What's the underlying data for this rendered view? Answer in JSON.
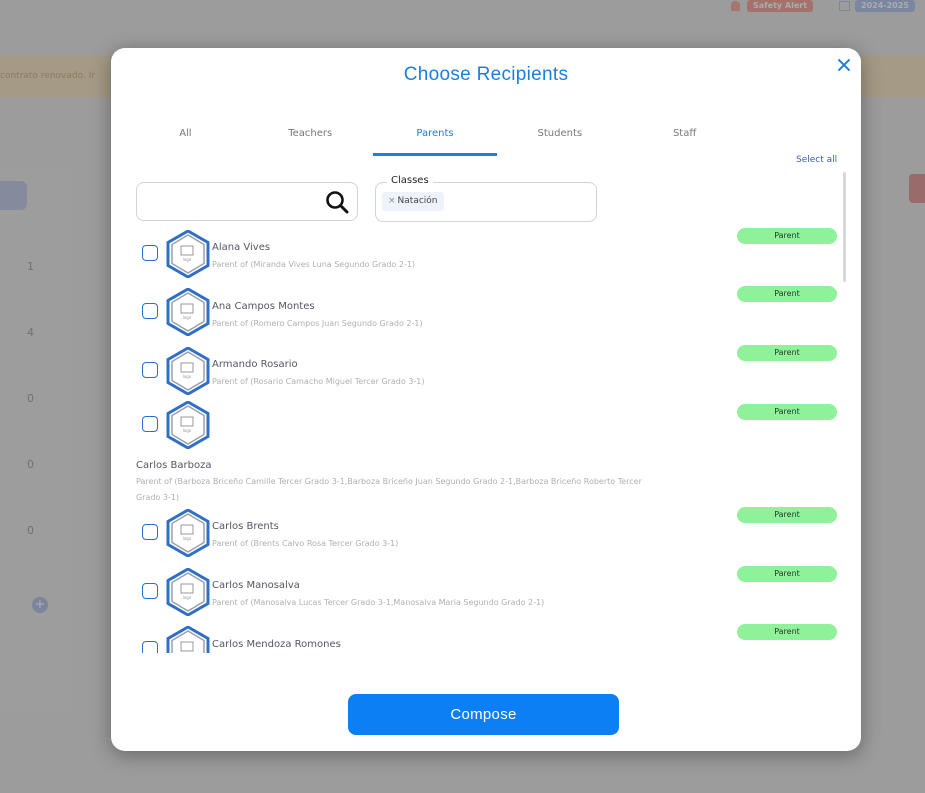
{
  "background": {
    "safety_alert": "Safety Alert",
    "school_year": "2024-2025",
    "banner_text": "contrato renovado. Ir",
    "side_numbers": [
      "1",
      "4",
      "0",
      "0",
      "0"
    ]
  },
  "modal": {
    "title": "Choose Recipients",
    "tabs": [
      "All",
      "Teachers",
      "Parents",
      "Students",
      "Staff"
    ],
    "active_tab": "Parents",
    "select_all": "Select all",
    "search": {
      "value": "",
      "placeholder": ""
    },
    "classes": {
      "label": "Classes",
      "chip": "Natación",
      "chip_remove": "×"
    },
    "recipients": [
      {
        "name": "Alana Vives",
        "sub": "Parent of (Miranda Vives Luna Segundo Grado 2-1)",
        "role": "Parent"
      },
      {
        "name": "Ana Campos Montes",
        "sub": "Parent of (Romero Campos Juan Segundo Grado 2-1)",
        "role": "Parent"
      },
      {
        "name": "Armando Rosario",
        "sub": "Parent of (Rosario Camacho Miguel Tercer Grado 3-1)",
        "role": "Parent"
      },
      {
        "name": "Carlos Barboza",
        "sub": "Parent of (Barboza Briceño Camille Tercer Grado 3-1,Barboza Briceño Juan Segundo Grado 2-1,Barboza Briceño Roberto Tercer Grado 3-1)",
        "sub_line1": "Parent of (Barboza Briceño Camille Tercer Grado 3-1,Barboza Briceño Juan Segundo Grado 2-1,Barboza Briceño Roberto Tercer",
        "sub_line2": "Grado 3-1)",
        "role": "Parent"
      },
      {
        "name": "Carlos Brents",
        "sub": "Parent of (Brents Calvo Rosa Tercer Grado 3-1)",
        "role": "Parent"
      },
      {
        "name": "Carlos Manosalva",
        "sub": "Parent of (Manosalva Lucas Tercer Grado 3-1,Manosalva Maria Segundo Grado 2-1)",
        "role": "Parent"
      },
      {
        "name": "Carlos Mendoza Romones",
        "sub": "",
        "role": "Parent"
      }
    ],
    "compose_label": "Compose",
    "colors": {
      "accent": "#1a7fe0",
      "button": "#0d7ff5",
      "badge": "#8ff19a"
    }
  }
}
